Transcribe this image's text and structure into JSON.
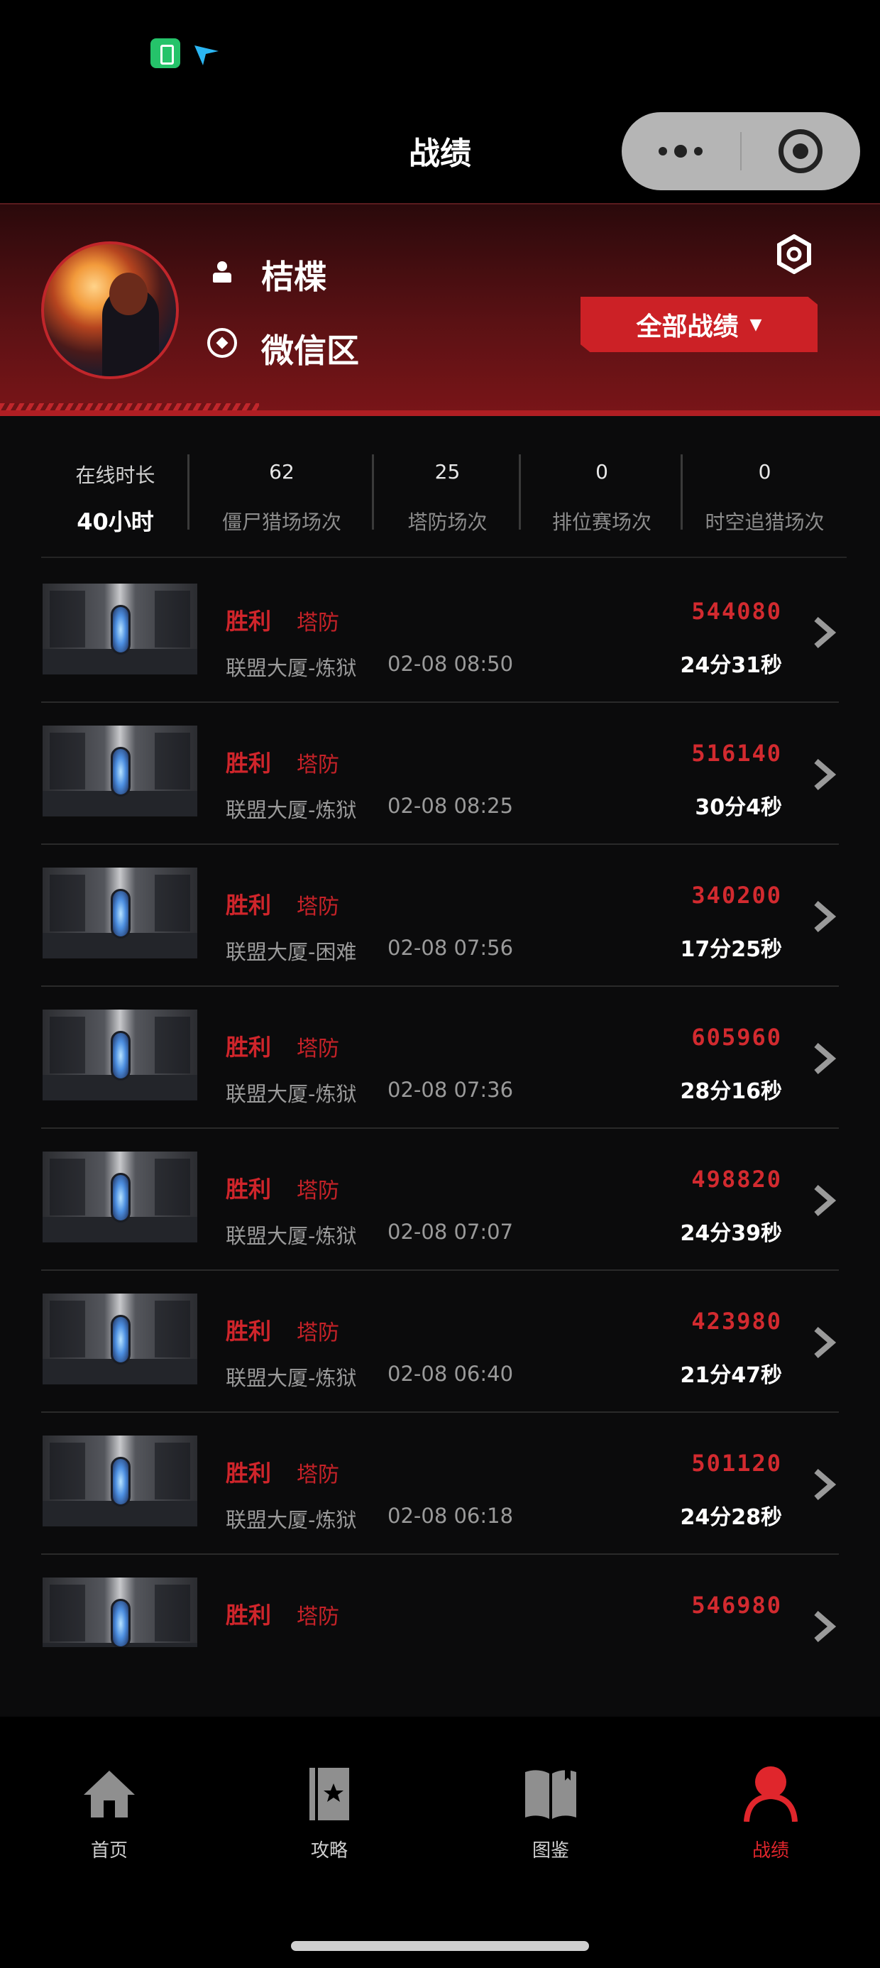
{
  "header": {
    "title": "战绩"
  },
  "profile": {
    "username": "桔楪",
    "server": "微信区",
    "filter_label": "全部战绩",
    "filter_caret": "▼"
  },
  "stats": [
    {
      "top": "在线时长",
      "bottom": "40小时"
    },
    {
      "top": "62",
      "bottom": "僵尸猎场场次"
    },
    {
      "top": "25",
      "bottom": "塔防场次"
    },
    {
      "top": "0",
      "bottom": "排位赛场次"
    },
    {
      "top": "0",
      "bottom": "时空追猎场次"
    }
  ],
  "records": [
    {
      "result": "胜利",
      "mode": "塔防",
      "map": "联盟大厦-炼狱",
      "time": "02-08 08:50",
      "score": "544080",
      "duration": "24分31秒"
    },
    {
      "result": "胜利",
      "mode": "塔防",
      "map": "联盟大厦-炼狱",
      "time": "02-08 08:25",
      "score": "516140",
      "duration": "30分4秒"
    },
    {
      "result": "胜利",
      "mode": "塔防",
      "map": "联盟大厦-困难",
      "time": "02-08 07:56",
      "score": "340200",
      "duration": "17分25秒"
    },
    {
      "result": "胜利",
      "mode": "塔防",
      "map": "联盟大厦-炼狱",
      "time": "02-08 07:36",
      "score": "605960",
      "duration": "28分16秒"
    },
    {
      "result": "胜利",
      "mode": "塔防",
      "map": "联盟大厦-炼狱",
      "time": "02-08 07:07",
      "score": "498820",
      "duration": "24分39秒"
    },
    {
      "result": "胜利",
      "mode": "塔防",
      "map": "联盟大厦-炼狱",
      "time": "02-08 06:40",
      "score": "423980",
      "duration": "21分47秒"
    },
    {
      "result": "胜利",
      "mode": "塔防",
      "map": "联盟大厦-炼狱",
      "time": "02-08 06:18",
      "score": "501120",
      "duration": "24分28秒"
    },
    {
      "result": "胜利",
      "mode": "塔防",
      "map": "",
      "time": "",
      "score": "546980",
      "duration": ""
    }
  ],
  "nav": {
    "home": "首页",
    "guide": "攻略",
    "codex": "图鉴",
    "record": "战绩"
  },
  "icons": {
    "status": [
      "battery-icon",
      "send-icon"
    ],
    "profile": [
      "user-icon",
      "server-icon",
      "settings-icon"
    ],
    "nav": [
      "home-icon",
      "guide-icon",
      "codex-icon",
      "record-icon"
    ]
  },
  "colors": {
    "accent": "#cc2126",
    "background": "#0b0b0c"
  }
}
